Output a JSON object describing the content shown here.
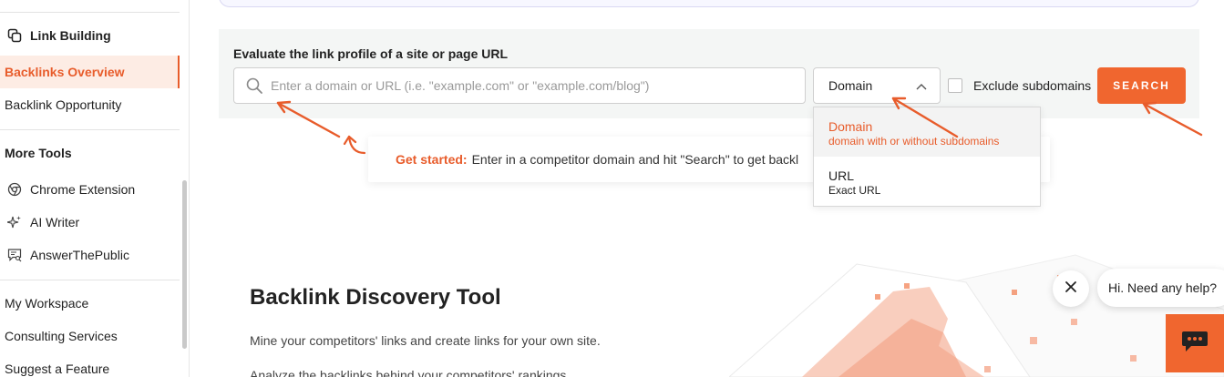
{
  "sidebar": {
    "link_building": "Link Building",
    "backlinks_overview": "Backlinks Overview",
    "backlink_opportunity": "Backlink Opportunity",
    "more_tools": "More Tools",
    "chrome_extension": "Chrome Extension",
    "ai_writer": "AI Writer",
    "answer_the_public": "AnswerThePublic",
    "my_workspace": "My Workspace",
    "consulting_services": "Consulting Services",
    "suggest_feature": "Suggest a Feature"
  },
  "search_panel": {
    "label": "Evaluate the link profile of a site or page URL",
    "placeholder": "Enter a domain or URL (i.e. \"example.com\" or \"example.com/blog\")",
    "select_value": "Domain",
    "exclude_label": "Exclude subdomains",
    "search_label": "SEARCH"
  },
  "dropdown": {
    "options": [
      {
        "title": "Domain",
        "subtitle": "domain with or without subdomains"
      },
      {
        "title": "URL",
        "subtitle": "Exact URL"
      }
    ]
  },
  "get_started": {
    "label": "Get started:",
    "text": "Enter in a competitor domain and hit \"Search\" to get backl"
  },
  "hero": {
    "title": "Backlink Discovery Tool",
    "p1": "Mine your competitors' links and create links for your own site.",
    "p2": "Analyze the backlinks behind your competitors' rankings"
  },
  "chat": {
    "greeting": "Hi. Need any help?"
  },
  "colors": {
    "accent": "#f0662f",
    "active_text": "#e85c2b",
    "active_bg": "#fdece4",
    "panel_bg": "#f4f6f5"
  }
}
